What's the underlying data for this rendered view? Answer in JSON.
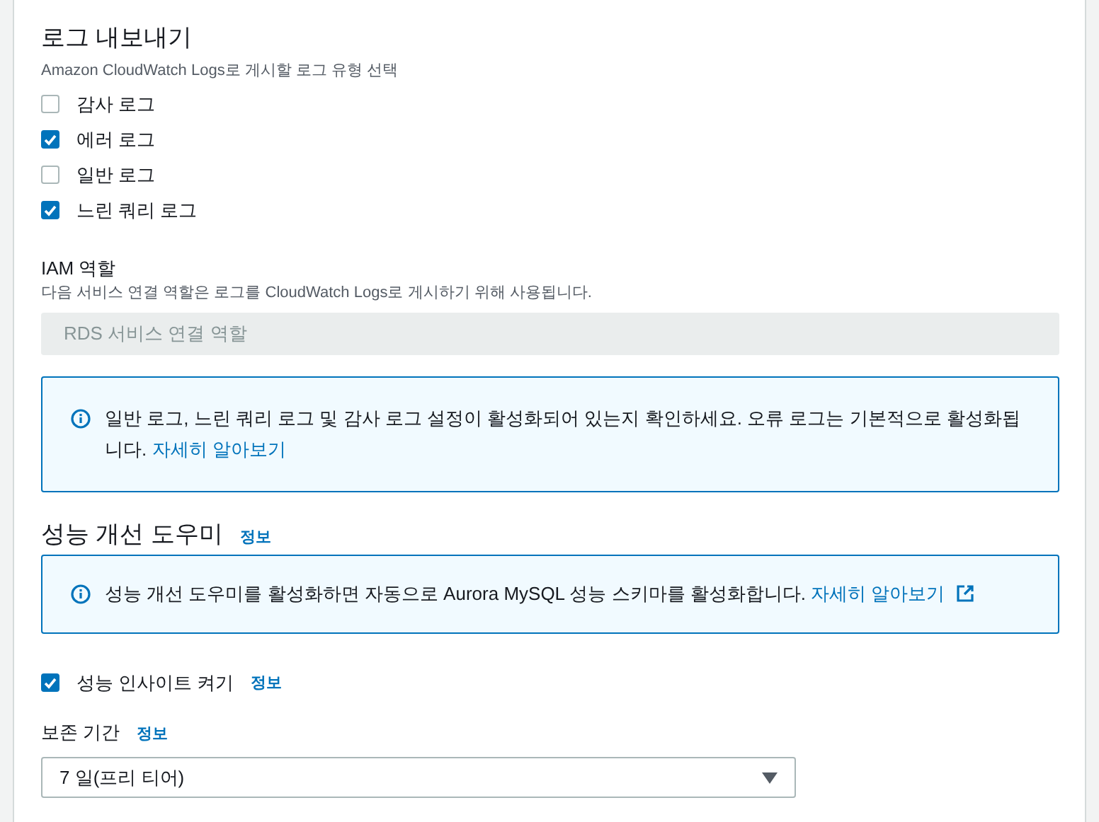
{
  "log_export": {
    "title": "로그 내보내기",
    "description": "Amazon CloudWatch Logs로 게시할 로그 유형 선택",
    "log_types": [
      {
        "label": "감사 로그",
        "checked": false
      },
      {
        "label": "에러 로그",
        "checked": true
      },
      {
        "label": "일반 로그",
        "checked": false
      },
      {
        "label": "느린 쿼리 로그",
        "checked": true
      }
    ]
  },
  "iam_role": {
    "label": "IAM 역할",
    "description": "다음 서비스 연결 역할은 로그를 CloudWatch Logs로 게시하기 위해 사용됩니다.",
    "value": "RDS 서비스 연결 역할",
    "disabled": true
  },
  "log_alert": {
    "text": "일반 로그, 느린 쿼리 로그 및 감사 로그 설정이 활성화되어 있는지 확인하세요. 오류 로그는 기본적으로 활성화됩니다.",
    "link": "자세히 알아보기"
  },
  "performance_insights": {
    "title": "성능 개선 도우미",
    "info": "정보",
    "alert": {
      "text": "성능 개선 도우미를 활성화하면 자동으로 Aurora MySQL 성능 스키마를 활성화합니다.",
      "link": "자세히 알아보기"
    },
    "enable": {
      "label": "성능 인사이트 켜기",
      "checked": true,
      "info": "정보"
    },
    "retention": {
      "label": "보존 기간",
      "info": "정보",
      "value": "7 일(프리 티어)"
    }
  }
}
